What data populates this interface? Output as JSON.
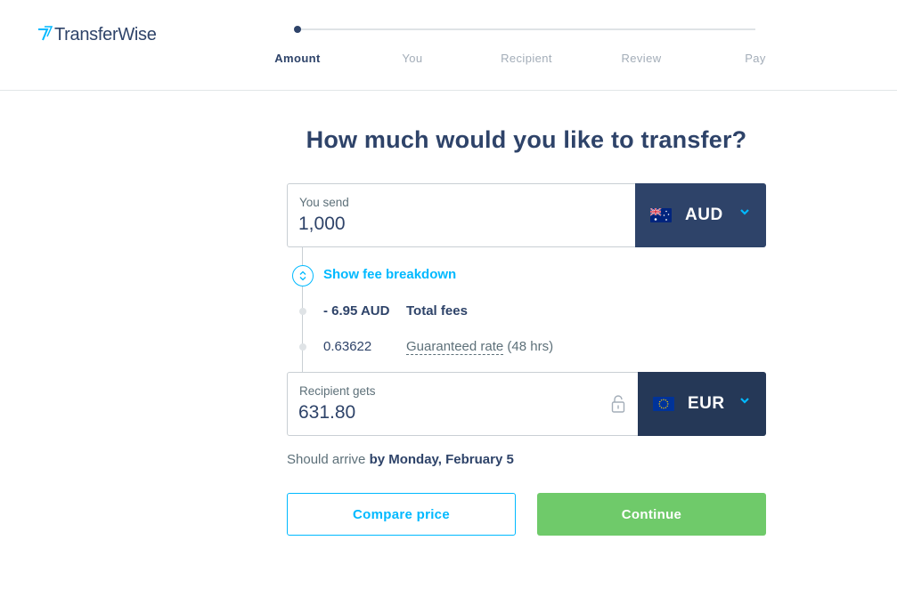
{
  "brand": {
    "name": "TransferWise",
    "color": "#2e4369",
    "accent": "#00b9ff"
  },
  "stepper": {
    "current_step": 1,
    "steps": [
      {
        "label": "Amount"
      },
      {
        "label": "You"
      },
      {
        "label": "Recipient"
      },
      {
        "label": "Review"
      },
      {
        "label": "Pay"
      }
    ]
  },
  "page": {
    "title": "How much would you like to transfer?"
  },
  "send": {
    "label": "You send",
    "value": "1,000",
    "currency": "AUD",
    "flag_icon": "australia-flag-icon"
  },
  "fees": {
    "toggle_label": "Show fee breakdown",
    "total_fee_amount": "- 6.95 AUD",
    "total_fee_label": "Total fees",
    "rate_value": "0.63622",
    "rate_label": "Guaranteed rate",
    "rate_hint": "(48 hrs)"
  },
  "receive": {
    "label": "Recipient gets",
    "value": "631.80",
    "currency": "EUR",
    "flag_icon": "eu-flag-icon"
  },
  "arrival": {
    "prefix": "Should arrive",
    "date": "by Monday, February 5"
  },
  "actions": {
    "compare_label": "Compare price",
    "continue_label": "Continue",
    "continue_color": "#6fca6a"
  }
}
